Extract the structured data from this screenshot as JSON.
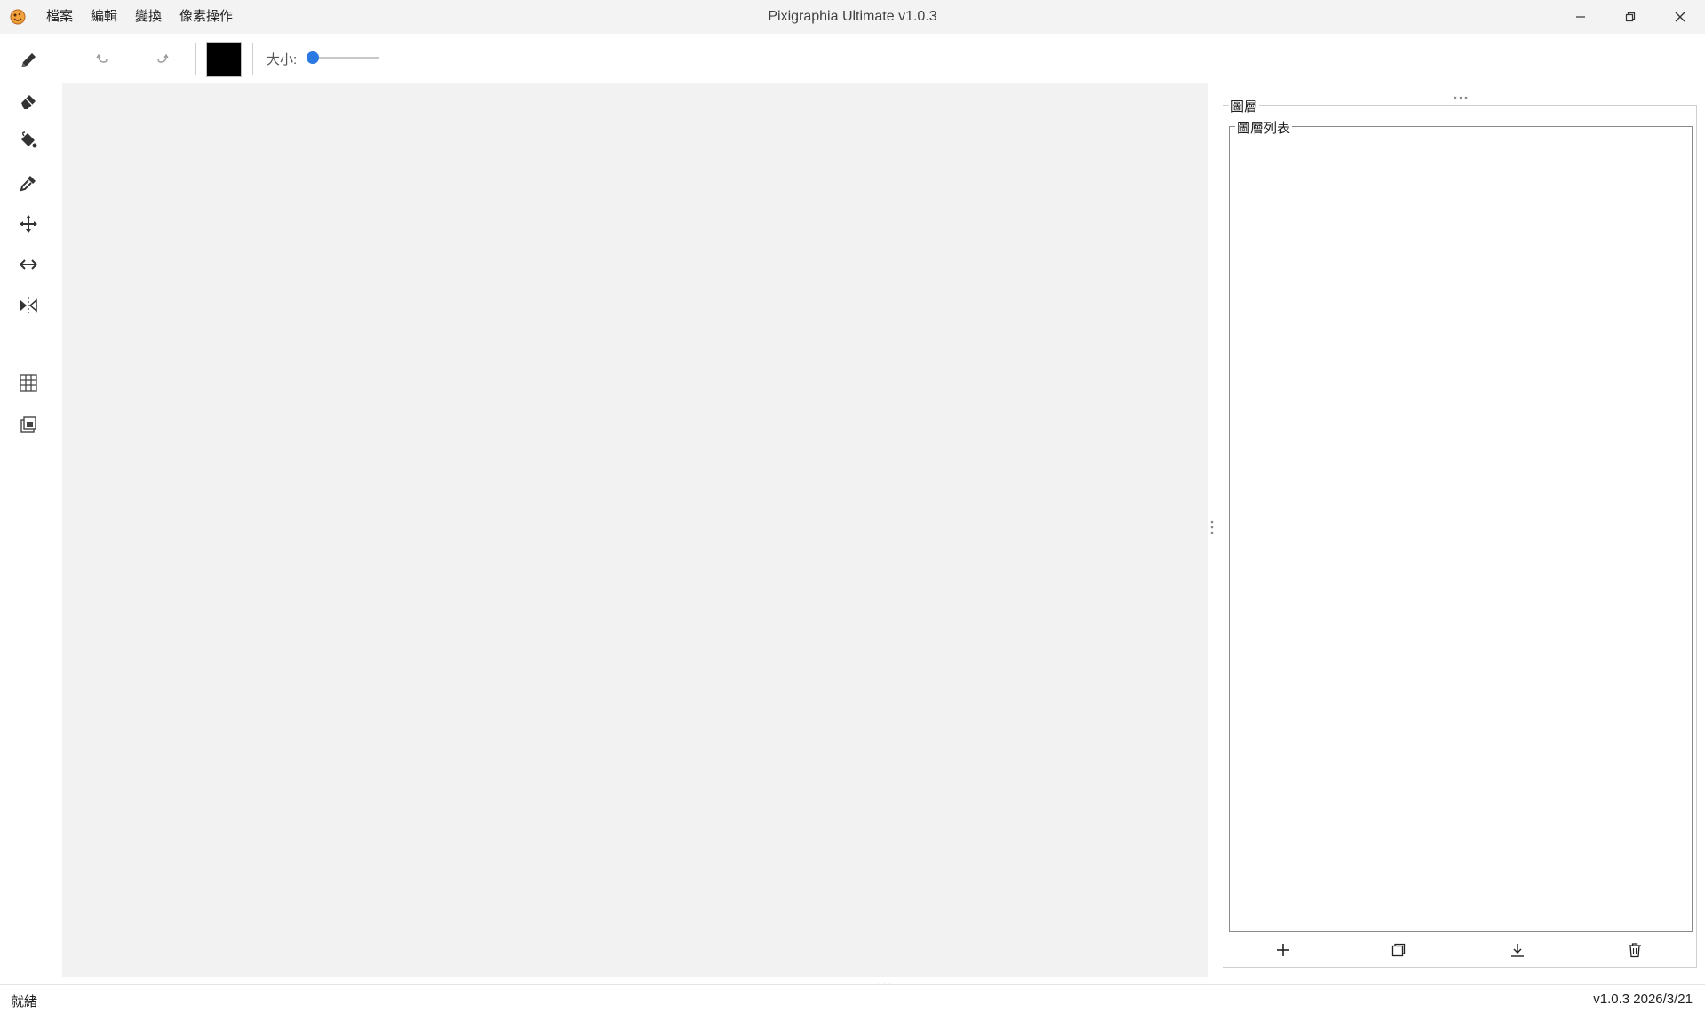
{
  "window": {
    "title": "Pixigraphia Ultimate v1.0.3",
    "app_icon": "app-logo-icon",
    "controls": [
      "minimize-icon",
      "restore-icon",
      "close-icon"
    ]
  },
  "menu": {
    "items": [
      "檔案",
      "編輯",
      "變換",
      "像素操作"
    ]
  },
  "options_bar": {
    "undo_icon": "undo-icon",
    "redo_icon": "redo-icon",
    "current_color": "#000000",
    "size_label": "大小:",
    "size_value_fraction": 0.0
  },
  "tools": [
    "pencil-icon",
    "eraser-icon",
    "fill-bucket-icon",
    "eyedropper-icon",
    "move-icon",
    "resize-horizontal-icon",
    "mirror-icon",
    "grid-icon",
    "layers-stack-icon"
  ],
  "layer_panel": {
    "group_title": "圖層",
    "list_title": "圖層列表",
    "buttons": [
      "add-layer-icon",
      "duplicate-layer-icon",
      "merge-down-icon",
      "delete-layer-icon"
    ]
  },
  "status": {
    "left": "就緒",
    "right": "v1.0.3 2026/3/21"
  },
  "colors": {
    "accent": "#2a7ae2",
    "canvas_bg": "#f2f2f2",
    "titlebar_bg": "#f3f3f3"
  }
}
